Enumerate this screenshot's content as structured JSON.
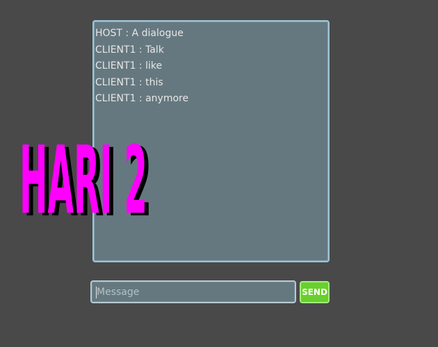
{
  "chat": {
    "messages": [
      "HOST : A dialogue",
      "CLIENT1 : Talk",
      "CLIENT1 : like",
      "CLIENT1 : this",
      "CLIENT1 : anymore"
    ]
  },
  "overlay": {
    "title": "HARI 2",
    "fill_color": "#ff00ff",
    "shadow_color": "#000000"
  },
  "composer": {
    "placeholder": "Message",
    "value": "",
    "send_label": "SEND"
  },
  "colors": {
    "background": "#494949",
    "panel": "#66787f",
    "panel_border": "#9ec4d6",
    "send_button": "#69cf2d"
  }
}
